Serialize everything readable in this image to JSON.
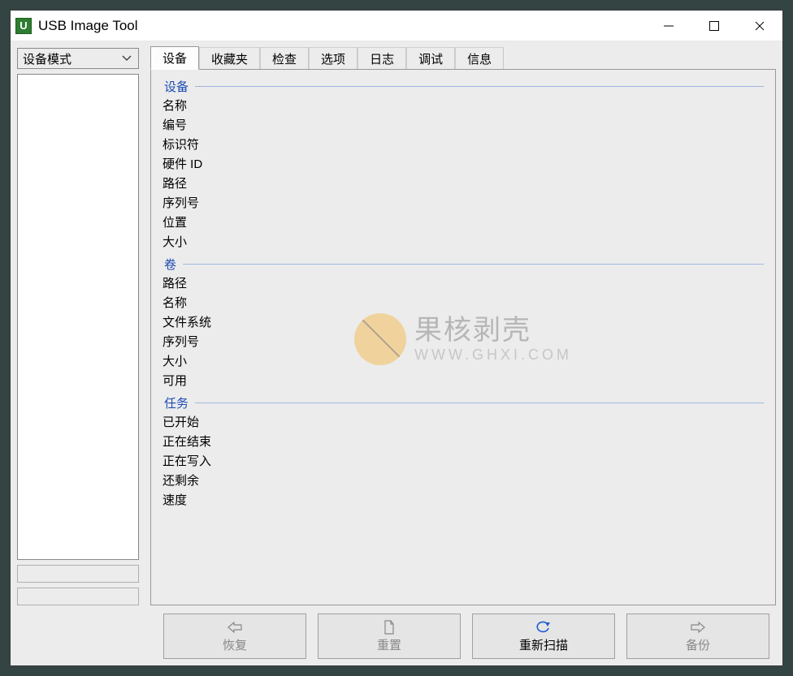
{
  "window": {
    "title": "USB Image Tool",
    "app_icon_letter": "U"
  },
  "mode_selector": {
    "value": "设备模式"
  },
  "tabs": [
    {
      "label": "设备",
      "active": true
    },
    {
      "label": "收藏夹",
      "active": false
    },
    {
      "label": "检查",
      "active": false
    },
    {
      "label": "选项",
      "active": false
    },
    {
      "label": "日志",
      "active": false
    },
    {
      "label": "调试",
      "active": false
    },
    {
      "label": "信息",
      "active": false
    }
  ],
  "groups": {
    "device": {
      "title": "设备",
      "fields": [
        "名称",
        "编号",
        "标识符",
        "硬件 ID",
        "路径",
        "序列号",
        "位置",
        "大小"
      ]
    },
    "volume": {
      "title": "卷",
      "fields": [
        "路径",
        "名称",
        "文件系统",
        "序列号",
        "大小",
        "可用"
      ]
    },
    "task": {
      "title": "任务",
      "fields": [
        "已开始",
        "正在结束",
        "正在写入",
        "还剩余",
        "速度"
      ]
    }
  },
  "buttons": {
    "restore": "恢复",
    "reset": "重置",
    "rescan": "重新扫描",
    "backup": "备份"
  },
  "watermark": {
    "text": "果核剥壳",
    "url": "WWW.GHXI.COM"
  }
}
